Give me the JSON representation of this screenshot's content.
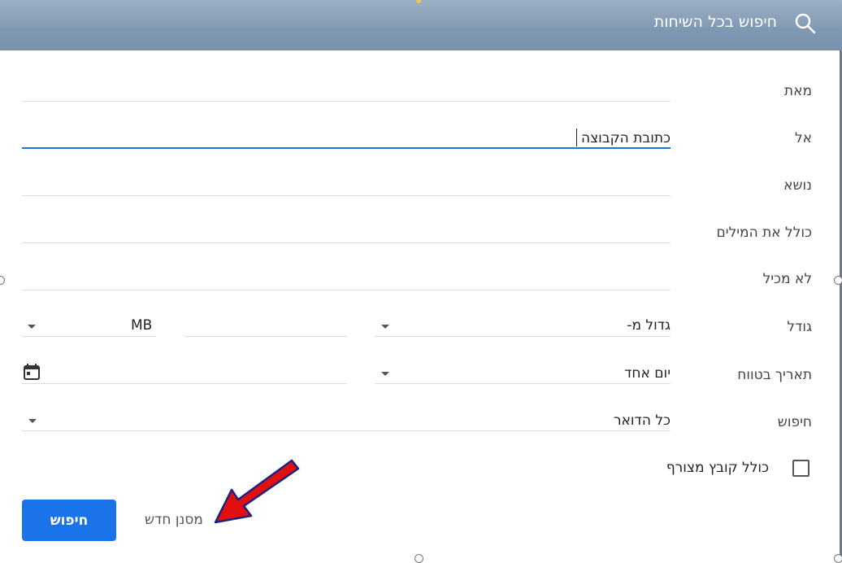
{
  "header": {
    "title": "חיפוש בכל השיחות",
    "icon": "search-icon"
  },
  "form": {
    "from_label": "מאת",
    "to_label": "אל",
    "to_value": "כתובת הקבוצה",
    "subject_label": "נושא",
    "has_words_label": "כולל את המילים",
    "doesnt_have_label": "לא מכיל",
    "size_label": "גודל",
    "size_operator": "גדול מ-",
    "size_unit": "MB",
    "date_label": "תאריך בטווח",
    "date_range": "יום אחד",
    "search_label": "חיפוש",
    "search_scope": "כל הדואר",
    "attachment_label": "כולל קובץ מצורף"
  },
  "actions": {
    "create_filter": "מסנן חדש",
    "search_button": "חיפוש"
  },
  "colors": {
    "accent": "#1a73e8",
    "arrow": "#e01010"
  }
}
